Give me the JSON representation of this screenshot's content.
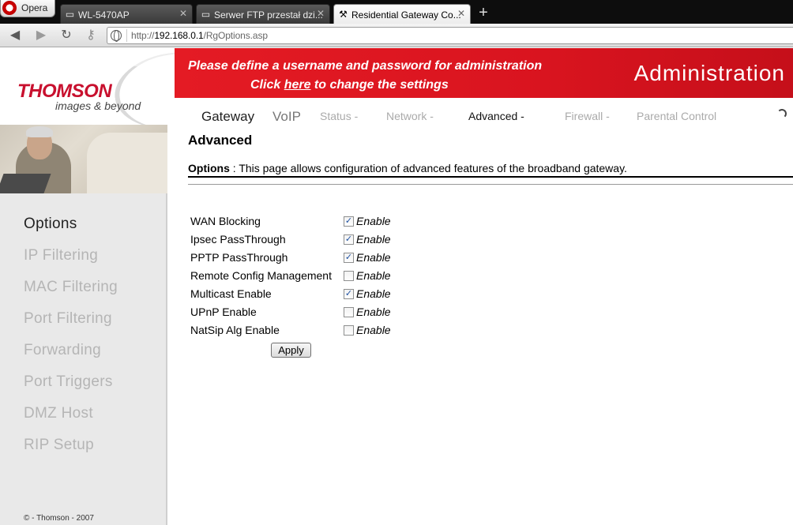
{
  "browser": {
    "menu_label": "Opera",
    "tabs": [
      {
        "title": "WL-5470AP",
        "icon": "page-icon",
        "active": false
      },
      {
        "title": "Serwer FTP przestał dzi...",
        "icon": "page-icon",
        "active": false
      },
      {
        "title": "Residential Gateway Co...",
        "icon": "tools-icon",
        "active": true
      }
    ],
    "url_prefix": "http://",
    "url_host": "192.168.0.1",
    "url_path": "/RgOptions.asp"
  },
  "header": {
    "logo_main": "THOMSON",
    "logo_sub": "images & beyond",
    "banner_line1": "Please define a username and password for administration",
    "banner_line2_pre": "Click ",
    "banner_line2_link": "here",
    "banner_line2_post": " to change the settings",
    "banner_title": "Administration",
    "accent_color": "#e41b24"
  },
  "topnav": {
    "gateway": "Gateway",
    "voip": "VoIP",
    "status": "Status -",
    "network": "Network -",
    "advanced": "Advanced -",
    "firewall": "Firewall -",
    "parental": "Parental Control"
  },
  "sidebar": {
    "items": [
      {
        "label": "Options",
        "active": true
      },
      {
        "label": "IP Filtering",
        "active": false
      },
      {
        "label": "MAC Filtering",
        "active": false
      },
      {
        "label": "Port Filtering",
        "active": false
      },
      {
        "label": "Forwarding",
        "active": false
      },
      {
        "label": "Port Triggers",
        "active": false
      },
      {
        "label": "DMZ Host",
        "active": false
      },
      {
        "label": "RIP Setup",
        "active": false
      }
    ],
    "copyright": "© - Thomson - 2007"
  },
  "main": {
    "heading": "Advanced",
    "desc_label": "Options",
    "desc_sep": " : ",
    "desc_text": "This page allows configuration of advanced features of the broadband gateway.",
    "options": [
      {
        "label": "WAN Blocking",
        "checked": true,
        "enable_label": "Enable"
      },
      {
        "label": "Ipsec PassThrough",
        "checked": true,
        "enable_label": "Enable"
      },
      {
        "label": "PPTP PassThrough",
        "checked": true,
        "enable_label": "Enable"
      },
      {
        "label": "Remote Config Management",
        "checked": false,
        "enable_label": "Enable"
      },
      {
        "label": "Multicast Enable",
        "checked": true,
        "enable_label": "Enable"
      },
      {
        "label": "UPnP Enable",
        "checked": false,
        "enable_label": "Enable"
      },
      {
        "label": "NatSip Alg Enable",
        "checked": false,
        "enable_label": "Enable"
      }
    ],
    "apply_label": "Apply"
  }
}
